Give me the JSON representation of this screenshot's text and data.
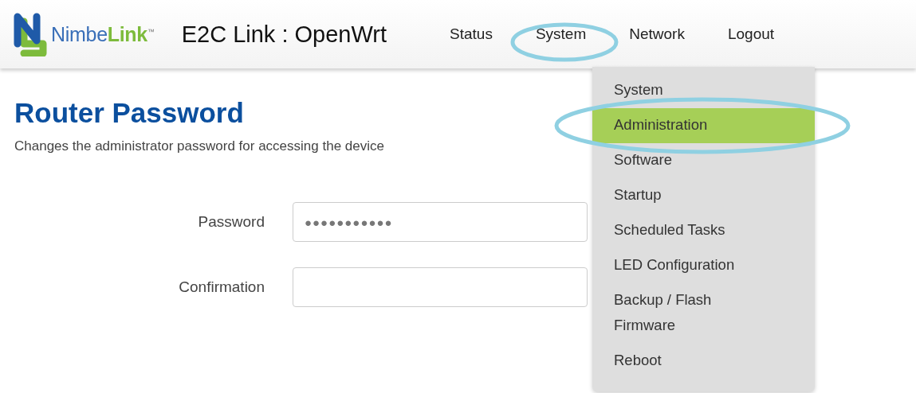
{
  "brand": {
    "name": "Nimbe",
    "accent": "Link",
    "mark": "™"
  },
  "title": "E2C Link : OpenWrt",
  "nav": [
    {
      "label": "Status",
      "circled": false
    },
    {
      "label": "System",
      "circled": true
    },
    {
      "label": "Network",
      "circled": false
    },
    {
      "label": "Logout",
      "circled": false
    }
  ],
  "menu": [
    {
      "label": "System",
      "selected": false,
      "circled": false
    },
    {
      "label": "Administration",
      "selected": true,
      "circled": true
    },
    {
      "label": "Software",
      "selected": false,
      "circled": false
    },
    {
      "label": "Startup",
      "selected": false,
      "circled": false
    },
    {
      "label": "Scheduled Tasks",
      "selected": false,
      "circled": false
    },
    {
      "label": "LED Configuration",
      "selected": false,
      "circled": false
    },
    {
      "label": "Backup / Flash Firmware",
      "selected": false,
      "circled": false
    },
    {
      "label": "Reboot",
      "selected": false,
      "circled": false
    }
  ],
  "heading": "Router Password",
  "description": "Changes the administrator password for accessing the device",
  "fields": [
    {
      "label": "Password",
      "value": "●●●●●●●●●●●"
    },
    {
      "label": "Confirmation"
    }
  ]
}
